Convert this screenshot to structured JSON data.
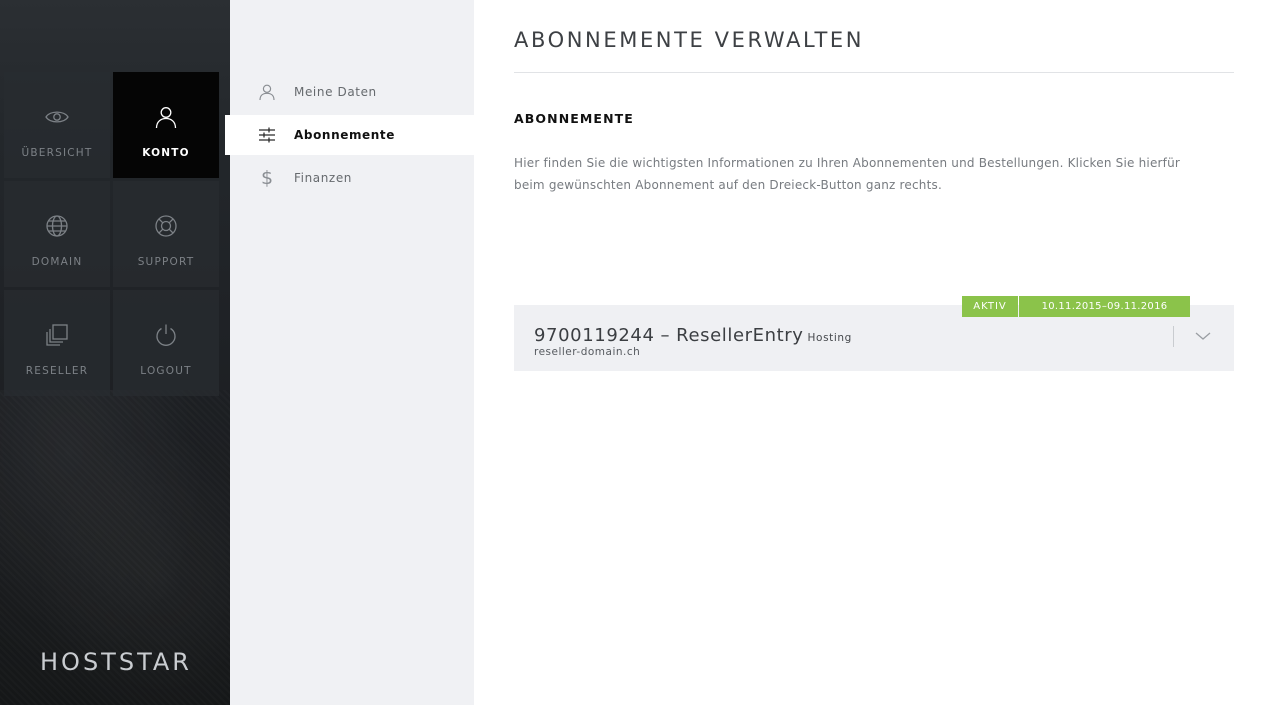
{
  "sidebar": {
    "tiles": [
      {
        "label": "ÜBERSICHT",
        "icon": "eye-icon"
      },
      {
        "label": "KONTO",
        "icon": "user-icon",
        "active": true
      },
      {
        "label": "DOMAIN",
        "icon": "globe-icon"
      },
      {
        "label": "SUPPORT",
        "icon": "lifebuoy-icon"
      },
      {
        "label": "RESELLER",
        "icon": "copy-icon"
      },
      {
        "label": "LOGOUT",
        "icon": "power-icon"
      }
    ],
    "logo": "HOSTSTAR"
  },
  "subnav": {
    "items": [
      {
        "label": "Meine Daten",
        "icon": "user-icon"
      },
      {
        "label": "Abonnemente",
        "icon": "sliders-icon",
        "active": true
      },
      {
        "label": "Finanzen",
        "icon": "dollar-icon"
      }
    ]
  },
  "main": {
    "title": "ABONNEMENTE VERWALTEN",
    "section_heading": "ABONNEMENTE",
    "intro_line1": "Hier finden Sie die wichtigsten Informationen zu Ihren Abonnementen und Bestellungen. Klicken Sie hierfür",
    "intro_line2": "beim gewünschten Abonnement auf den Dreieck-Button ganz rechts.",
    "subscription": {
      "number": "9700119244",
      "separator": "–",
      "name": "ResellerEntry",
      "type": "Hosting",
      "domain": "reseller-domain.ch",
      "status": "AKTIV",
      "period": "10.11.2015–09.11.2016",
      "toggle_icon": "chevron-down-icon"
    }
  },
  "colors": {
    "accent_green": "#8bc34a",
    "sidebar_dark": "#1f2226",
    "active_tile": "#050505",
    "subnav_bg": "#f0f1f4",
    "card_bg": "#eff0f3"
  }
}
